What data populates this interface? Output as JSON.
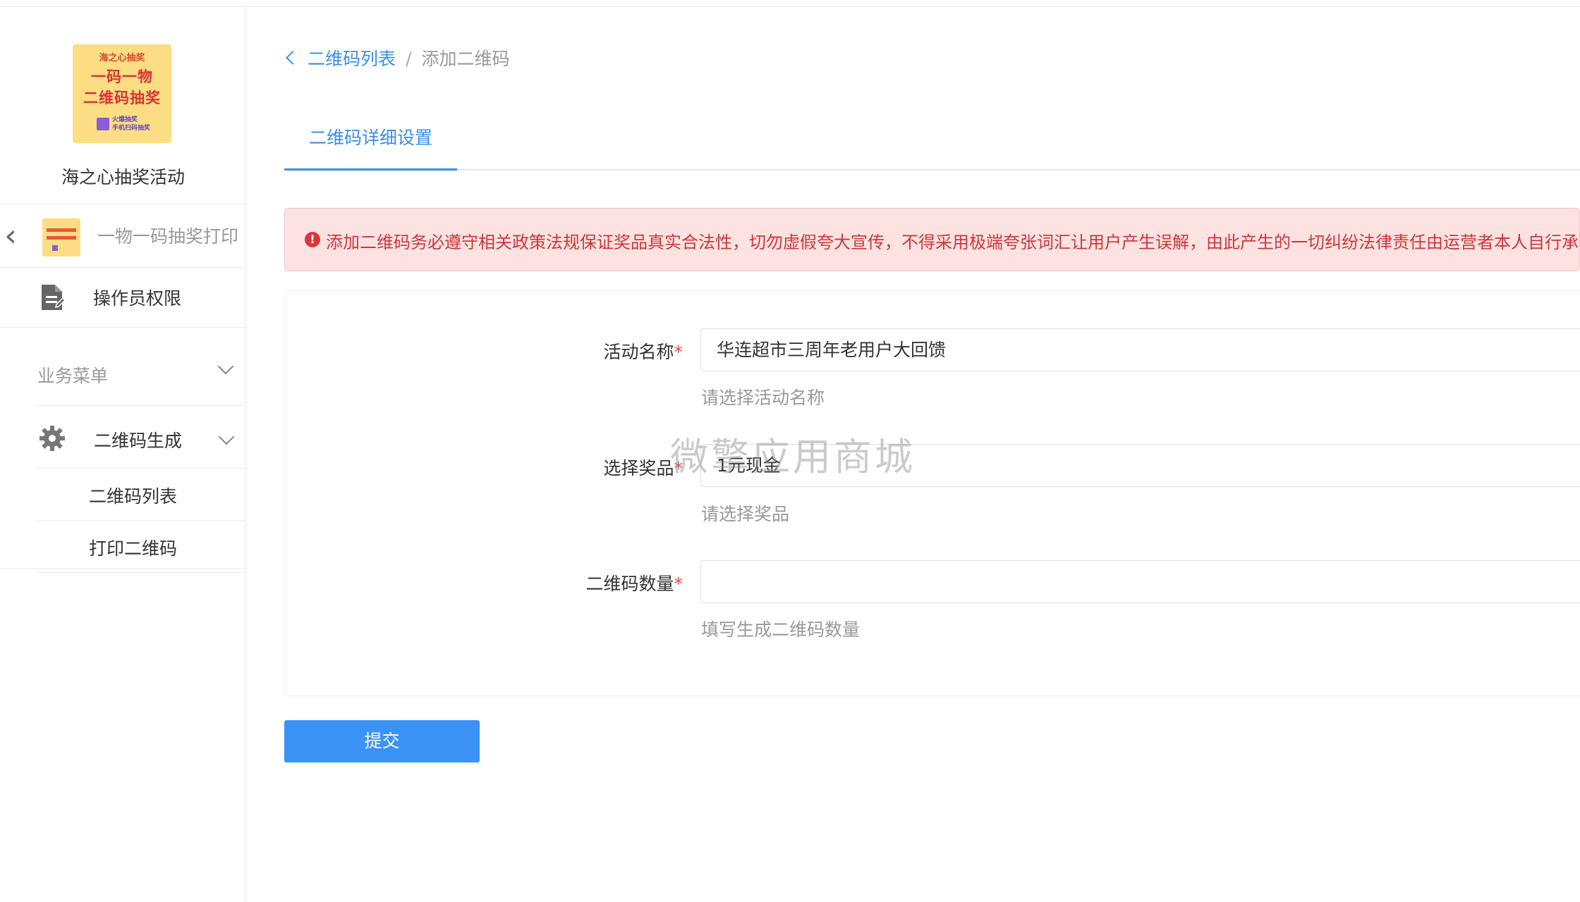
{
  "sidebar": {
    "app_logo_line1": "海之心抽奖",
    "app_logo_line2": "一码一物",
    "app_logo_line3": "二维码抽奖",
    "app_logo_line4": "火爆抽奖\n手机扫码抽奖",
    "app_name": "海之心抽奖活动",
    "mini_app_name": "一物一码抽奖打印",
    "operator_permission": "操作员权限",
    "section_label": "业务菜单",
    "qr_generate": "二维码生成",
    "sub_items": [
      "二维码列表",
      "打印二维码"
    ]
  },
  "breadcrumb": {
    "parent": "二维码列表",
    "separator": "/",
    "current": "添加二维码"
  },
  "tabs": {
    "active": "二维码详细设置"
  },
  "alert": {
    "text": "添加二维码务必遵守相关政策法规保证奖品真实合法性，切勿虚假夸大宣传，不得采用极端夸张词汇让用户产生误解，由此产生的一切纠纷法律责任由运营者本人自行承担"
  },
  "form": {
    "activity": {
      "label": "活动名称",
      "required_mark": "*",
      "value": "华连超市三周年老用户大回馈",
      "hint": "请选择活动名称"
    },
    "prize": {
      "label": "选择奖品",
      "required_mark": "*",
      "value": "1元现金",
      "hint": "请选择奖品"
    },
    "quantity": {
      "label": "二维码数量",
      "required_mark": "*",
      "value": "",
      "hint": "填写生成二维码数量"
    },
    "submit": "提交"
  },
  "watermark": "微擎应用商城",
  "colors": {
    "primary": "#3a8ee6",
    "button": "#3a93f4",
    "alert_bg": "#fde2e2",
    "alert_text": "#c9383a",
    "required": "#e64545"
  }
}
